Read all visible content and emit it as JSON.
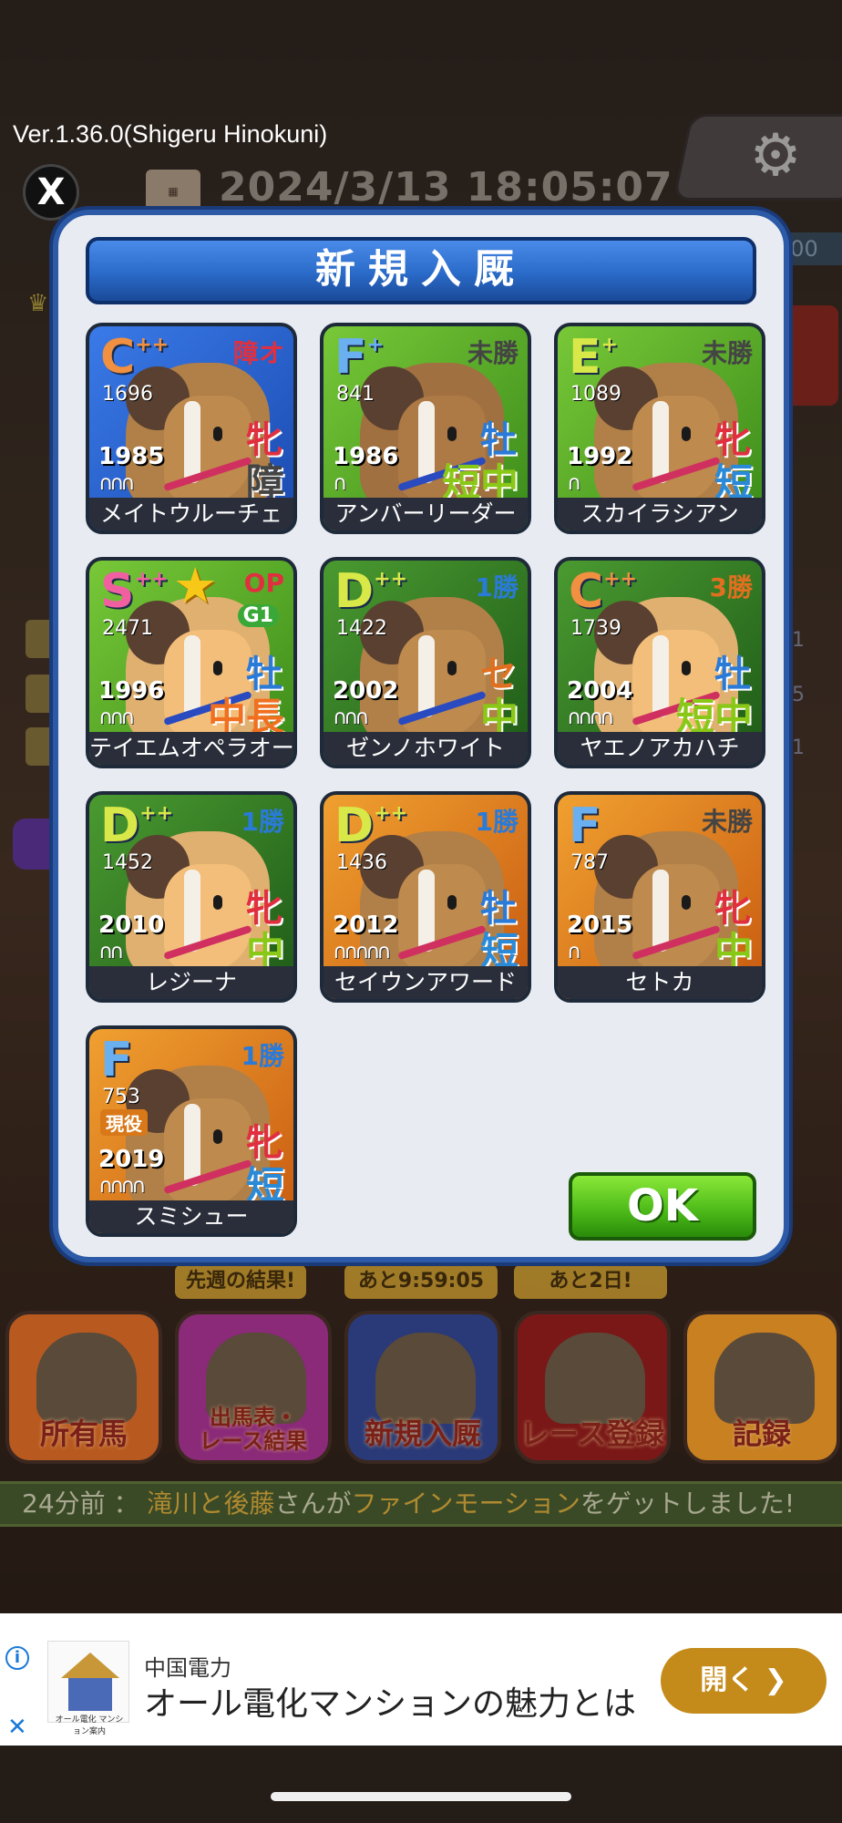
{
  "app": {
    "version": "Ver.1.36.0(Shigeru Hinokuni)",
    "datetime": "2024/3/13 18:05:07",
    "x_label": "X"
  },
  "modal": {
    "title": "新規入厩",
    "ok_label": "OK",
    "horses": [
      {
        "grade": "C",
        "plus": "++",
        "rating": "1696",
        "status": "障オ",
        "sex": "牝",
        "distance": "障",
        "year": "1985",
        "shoes": "∩∩∩",
        "name": "メイトウルーチェ",
        "card_color": "blue"
      },
      {
        "grade": "F",
        "plus": "+",
        "rating": "841",
        "status": "未勝",
        "sex": "牡",
        "distance": "短中",
        "year": "1986",
        "shoes": "∩",
        "name": "アンバーリーダー",
        "card_color": "green"
      },
      {
        "grade": "E",
        "plus": "+",
        "rating": "1089",
        "status": "未勝",
        "sex": "牝",
        "distance": "短",
        "year": "1992",
        "shoes": "∩",
        "name": "スカイラシアン",
        "card_color": "green"
      },
      {
        "grade": "S",
        "plus": "++",
        "rating": "2471",
        "status": "OP",
        "badge": "G1",
        "sex": "牡",
        "distance": "中長",
        "year": "1996",
        "shoes": "∩∩∩",
        "name": "テイエムオペラオー",
        "card_color": "green"
      },
      {
        "grade": "D",
        "plus": "++",
        "rating": "1422",
        "status": "1勝",
        "sex": "セ",
        "distance": "中",
        "year": "2002",
        "shoes": "∩∩∩",
        "name": "ゼンノホワイト",
        "card_color": "dgreen"
      },
      {
        "grade": "C",
        "plus": "++",
        "rating": "1739",
        "status": "3勝",
        "sex": "牡",
        "distance": "短中",
        "year": "2004",
        "shoes": "∩∩∩∩",
        "name": "ヤエノアカハチ",
        "card_color": "dgreen"
      },
      {
        "grade": "D",
        "plus": "++",
        "rating": "1452",
        "status": "1勝",
        "sex": "牝",
        "distance": "中",
        "year": "2010",
        "shoes": "∩∩",
        "name": "レジーナ",
        "card_color": "dgreen"
      },
      {
        "grade": "D",
        "plus": "++",
        "rating": "1436",
        "status": "1勝",
        "sex": "牡",
        "distance": "短",
        "year": "2012",
        "shoes": "∩∩∩∩∩",
        "name": "セイウンアワード",
        "card_color": "orange"
      },
      {
        "grade": "F",
        "plus": "",
        "rating": "787",
        "status": "未勝",
        "sex": "牝",
        "distance": "中",
        "year": "2015",
        "shoes": "∩",
        "name": "セトカ",
        "card_color": "orange"
      },
      {
        "grade": "F",
        "plus": "",
        "rating": "753",
        "status": "1勝",
        "active": "現役",
        "sex": "牝",
        "distance": "短",
        "year": "2019",
        "shoes": "∩∩∩∩",
        "name": "スミシュー",
        "card_color": "orange"
      }
    ]
  },
  "nav": {
    "tags": [
      "先週の結果!",
      "あと9:59:05",
      "あと2日!"
    ],
    "buttons": [
      "所有馬",
      "出馬表・\nレース結果",
      "新規入厩",
      "レース登録",
      "記録"
    ]
  },
  "ticker": {
    "time": "24分前 ：",
    "name": "滝川と後藤",
    "mid": "さんが",
    "horse": "ファインモーション",
    "end": "をゲットしました!"
  },
  "ad": {
    "company": "中国電力",
    "headline": "オール電化マンションの魅力とは",
    "cta": "開く",
    "logo_text": "オール電化 マンション案内"
  },
  "colors": {
    "modal_border": "#2c5aa6",
    "title_bar": "#2a6ac8",
    "ok_button": "#4ab818",
    "ad_cta": "#c48a1a"
  },
  "icons": {
    "settings": "gear-icon",
    "social": "x-logo-icon",
    "calendar": "calendar-icon",
    "star": "star-icon"
  }
}
